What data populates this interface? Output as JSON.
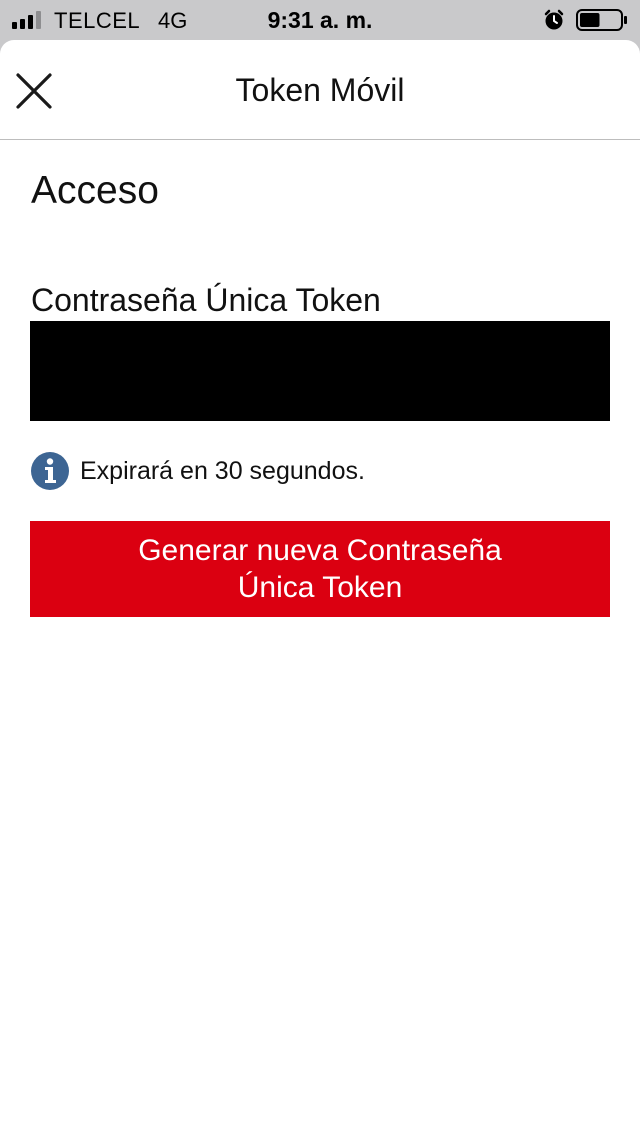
{
  "status_bar": {
    "carrier": "TELCEL",
    "network": "4G",
    "time": "9:31 a. m.",
    "signal_bars_active": 3,
    "signal_bars_total": 4,
    "battery_level": 0.5,
    "icons": [
      "signal-icon",
      "alarm-icon",
      "battery-icon"
    ]
  },
  "nav": {
    "title": "Token Móvil",
    "close_icon": "close-icon"
  },
  "section": {
    "title": "Acceso"
  },
  "token": {
    "label": "Contraseña Única Token",
    "value": ""
  },
  "info": {
    "icon": "info-icon",
    "text": "Expirará en 30 segundos."
  },
  "generate_button": {
    "line1": "Generar nueva Contraseña",
    "line2": "Única Token"
  },
  "colors": {
    "accent_red": "#db0011",
    "info_blue": "#3d6593",
    "status_bar_bg": "#c9c9cb"
  }
}
